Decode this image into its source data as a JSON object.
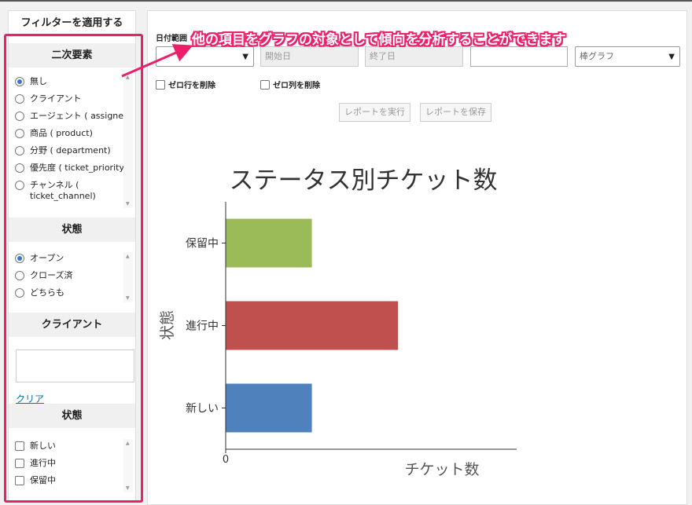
{
  "sidebar": {
    "apply_label": "フィルターを適用する",
    "secondary": {
      "title": "二次要素",
      "options": [
        "無し",
        "クライアント",
        "エージェント ( assignee)",
        "商品 ( product)",
        "分野 ( department)",
        "優先度 ( ticket_priority)",
        "チャンネル ( ticket_channel)"
      ],
      "selected": 0
    },
    "status": {
      "title": "状態",
      "options": [
        "オープン",
        "クローズ済",
        "どちらも"
      ],
      "selected": 0
    },
    "client": {
      "title": "クライアント",
      "clear_label": "クリア"
    },
    "state": {
      "title": "状態",
      "options": [
        "新しい",
        "進行中",
        "保留中"
      ]
    }
  },
  "main": {
    "date_range_label": "日付範囲",
    "start_placeholder": "開始日",
    "end_placeholder": "終了日",
    "chart_type_value": "棒グラフ",
    "zero_row_label": "ゼロ行を削除",
    "zero_col_label": "ゼロ列を削除",
    "run_label": "レポートを実行",
    "save_label": "レポートを保存"
  },
  "callout": {
    "text": "他の項目をグラフの対象として傾向を分析することができます"
  },
  "colors": {
    "highlight": "#ec1f6b",
    "green": "#9bbb59",
    "red": "#c0504d",
    "blue": "#4f81bd"
  },
  "chart_data": {
    "type": "bar",
    "orientation": "horizontal",
    "title": "ステータス別チケット数",
    "xlabel": "チケット数",
    "ylabel": "状態",
    "categories": [
      "保留中",
      "進行中",
      "新しい"
    ],
    "values": [
      2,
      4,
      2
    ],
    "colors": [
      "#9bbb59",
      "#c0504d",
      "#4f81bd"
    ],
    "xlim": [
      0,
      10
    ],
    "x_ticks": [
      "0",
      "10"
    ]
  }
}
